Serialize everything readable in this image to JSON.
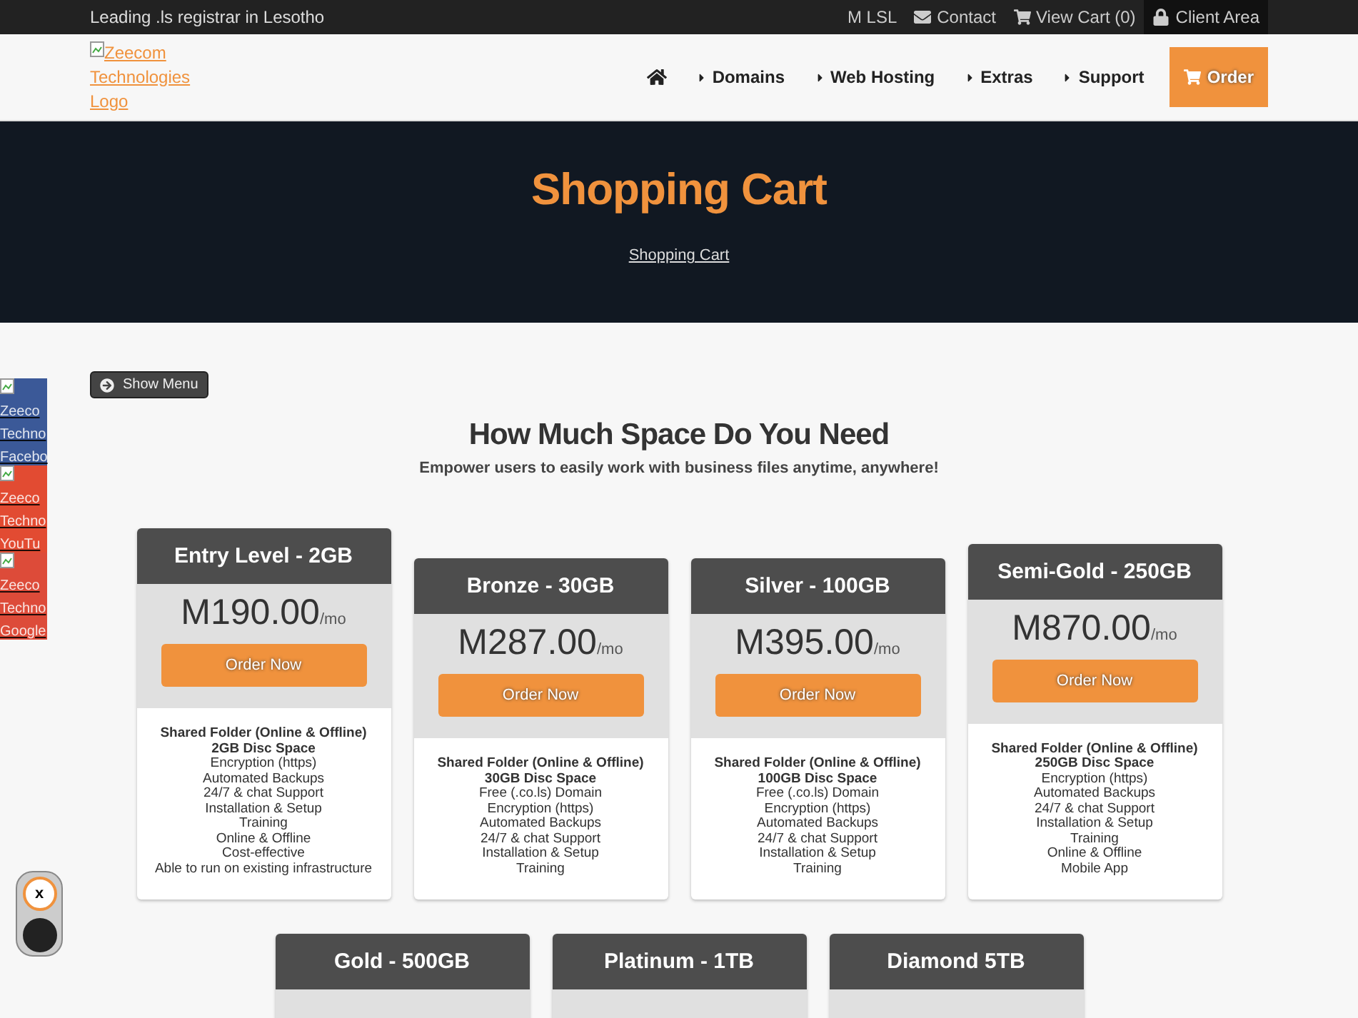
{
  "top_bar": {
    "tagline": "Leading .ls registrar in Lesotho",
    "links": [
      {
        "kind": "text",
        "label": "M LSL",
        "highlighted": false
      },
      {
        "kind": "mail",
        "label": "Contact",
        "highlighted": false
      },
      {
        "kind": "cart",
        "label": "View Cart (0)",
        "highlighted": false
      },
      {
        "kind": "lock",
        "label": "Client Area",
        "highlighted": true
      }
    ]
  },
  "header": {
    "logo_alt": "Zeecom Technologies Logo",
    "nav": [
      {
        "kind": "home"
      },
      {
        "kind": "menu",
        "label": "Domains"
      },
      {
        "kind": "menu",
        "label": "Web Hosting"
      },
      {
        "kind": "menu",
        "label": "Extras"
      },
      {
        "kind": "menu",
        "label": "Support"
      },
      {
        "kind": "order",
        "label": "Order"
      }
    ]
  },
  "hero": {
    "title": "Shopping Cart",
    "breadcrumb": "Shopping Cart"
  },
  "social_tabs": [
    {
      "alt": "Zeeco Techno Facebo",
      "color": "#3b5998"
    },
    {
      "alt": "Zeeco Techno YouTu",
      "color": "#e24b32"
    },
    {
      "alt": "Zeeco Techno Google",
      "color": "#dd4b39"
    }
  ],
  "show_menu": "Show Menu",
  "section": {
    "title": "How Much Space Do You Need",
    "subtitle": "Empower users to easily work with business files anytime, anywhere!"
  },
  "plans": [
    {
      "name": "Entry Level - 2GB",
      "price": "M190.00",
      "period": "/mo",
      "button": "Order Now",
      "features": [
        {
          "text": "Shared Folder (Online & Offline)",
          "bold": true
        },
        {
          "text": "2GB Disc Space",
          "bold": true
        },
        {
          "text": "Encryption (https)",
          "bold": false
        },
        {
          "text": "Automated Backups",
          "bold": false
        },
        {
          "text": "24/7 & chat Support",
          "bold": false
        },
        {
          "text": "Installation & Setup",
          "bold": false
        },
        {
          "text": "Training",
          "bold": false
        },
        {
          "text": "Online & Offline",
          "bold": false
        },
        {
          "text": "Cost-effective",
          "bold": false
        },
        {
          "text": "Able to run on existing infrastructure",
          "bold": false
        }
      ]
    },
    {
      "name": "Bronze - 30GB",
      "price": "M287.00",
      "period": "/mo",
      "button": "Order Now",
      "features": [
        {
          "text": "Shared Folder (Online & Offline)",
          "bold": true
        },
        {
          "text": "30GB Disc Space",
          "bold": true
        },
        {
          "text": "Free (.co.ls) Domain",
          "bold": false
        },
        {
          "text": "Encryption (https)",
          "bold": false
        },
        {
          "text": "Automated Backups",
          "bold": false
        },
        {
          "text": "24/7 & chat Support",
          "bold": false
        },
        {
          "text": "Installation & Setup",
          "bold": false
        },
        {
          "text": "Training",
          "bold": false
        }
      ]
    },
    {
      "name": "Silver - 100GB",
      "price": "M395.00",
      "period": "/mo",
      "button": "Order Now",
      "features": [
        {
          "text": "Shared Folder (Online & Offline)",
          "bold": true
        },
        {
          "text": "100GB Disc Space",
          "bold": true
        },
        {
          "text": "Free (.co.ls) Domain",
          "bold": false
        },
        {
          "text": "Encryption (https)",
          "bold": false
        },
        {
          "text": "Automated Backups",
          "bold": false
        },
        {
          "text": "24/7 & chat Support",
          "bold": false
        },
        {
          "text": "Installation & Setup",
          "bold": false
        },
        {
          "text": "Training",
          "bold": false
        }
      ]
    },
    {
      "name": "Semi-Gold - 250GB",
      "price": "M870.00",
      "period": "/mo",
      "button": "Order Now",
      "features": [
        {
          "text": "Shared Folder (Online & Offline)",
          "bold": true
        },
        {
          "text": "250GB Disc Space",
          "bold": true
        },
        {
          "text": "Encryption (https)",
          "bold": false
        },
        {
          "text": "Automated Backups",
          "bold": false
        },
        {
          "text": "24/7 & chat Support",
          "bold": false
        },
        {
          "text": "Installation & Setup",
          "bold": false
        },
        {
          "text": "Training",
          "bold": false
        },
        {
          "text": "Online & Offline",
          "bold": false
        },
        {
          "text": "Mobile App",
          "bold": false
        }
      ]
    }
  ],
  "more_plans": [
    {
      "name": "Gold - 500GB"
    },
    {
      "name": "Platinum - 1TB"
    },
    {
      "name": "Diamond 5TB"
    }
  ],
  "chat_toggle": {
    "close": "x"
  }
}
